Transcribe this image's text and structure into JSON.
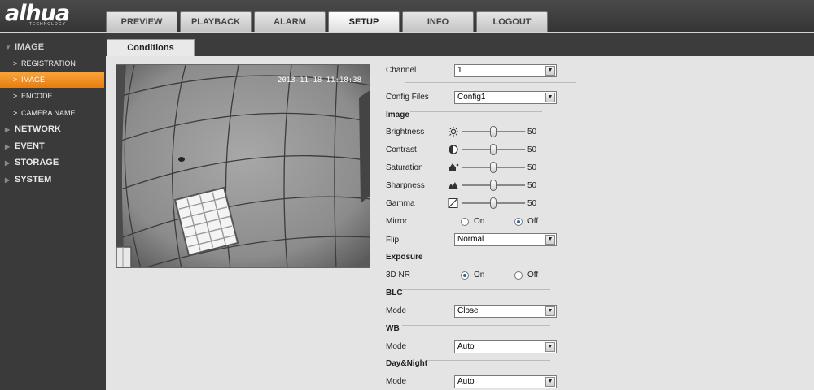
{
  "brand": {
    "logo": "alhua",
    "tagline": "TECHNOLOGY"
  },
  "nav": {
    "tabs": [
      {
        "label": "PREVIEW"
      },
      {
        "label": "PLAYBACK"
      },
      {
        "label": "ALARM"
      },
      {
        "label": "SETUP",
        "active": true
      },
      {
        "label": "INFO"
      },
      {
        "label": "LOGOUT"
      }
    ]
  },
  "sidebar": {
    "image": "IMAGE",
    "image_items": [
      "REGISTRATION",
      "IMAGE",
      "ENCODE",
      "CAMERA NAME"
    ],
    "active_item": "IMAGE",
    "network": "NETWORK",
    "event": "EVENT",
    "storage": "STORAGE",
    "system": "SYSTEM"
  },
  "tab": {
    "label": "Conditions"
  },
  "preview": {
    "timestamp": "2013-11-18 11:18:38"
  },
  "form": {
    "channel": {
      "label": "Channel",
      "value": "1"
    },
    "config_files": {
      "label": "Config Files",
      "value": "Config1"
    },
    "image_section": "Image",
    "sliders": {
      "brightness": {
        "label": "Brightness",
        "value": "50",
        "level": 0.5
      },
      "contrast": {
        "label": "Contrast",
        "value": "50",
        "level": 0.5
      },
      "saturation": {
        "label": "Saturation",
        "value": "50",
        "level": 0.5
      },
      "sharpness": {
        "label": "Sharpness",
        "value": "50",
        "level": 0.5
      },
      "gamma": {
        "label": "Gamma",
        "value": "50",
        "level": 0.5
      }
    },
    "mirror": {
      "label": "Mirror",
      "on": "On",
      "off": "Off",
      "selected": "Off"
    },
    "flip": {
      "label": "Flip",
      "value": "Normal"
    },
    "exposure_section": "Exposure",
    "nr3d": {
      "label": "3D NR",
      "on": "On",
      "off": "Off",
      "selected": "On"
    },
    "blc_section": "BLC",
    "blc_mode": {
      "label": "Mode",
      "value": "Close"
    },
    "wb_section": "WB",
    "wb_mode": {
      "label": "Mode",
      "value": "Auto"
    },
    "daynight_section": "Day&Night",
    "daynight_mode": {
      "label": "Mode",
      "value": "Auto"
    }
  },
  "colors": {
    "accent": "#f29022",
    "header": "#3f3f3f",
    "sidebar": "#3a3a3a"
  }
}
